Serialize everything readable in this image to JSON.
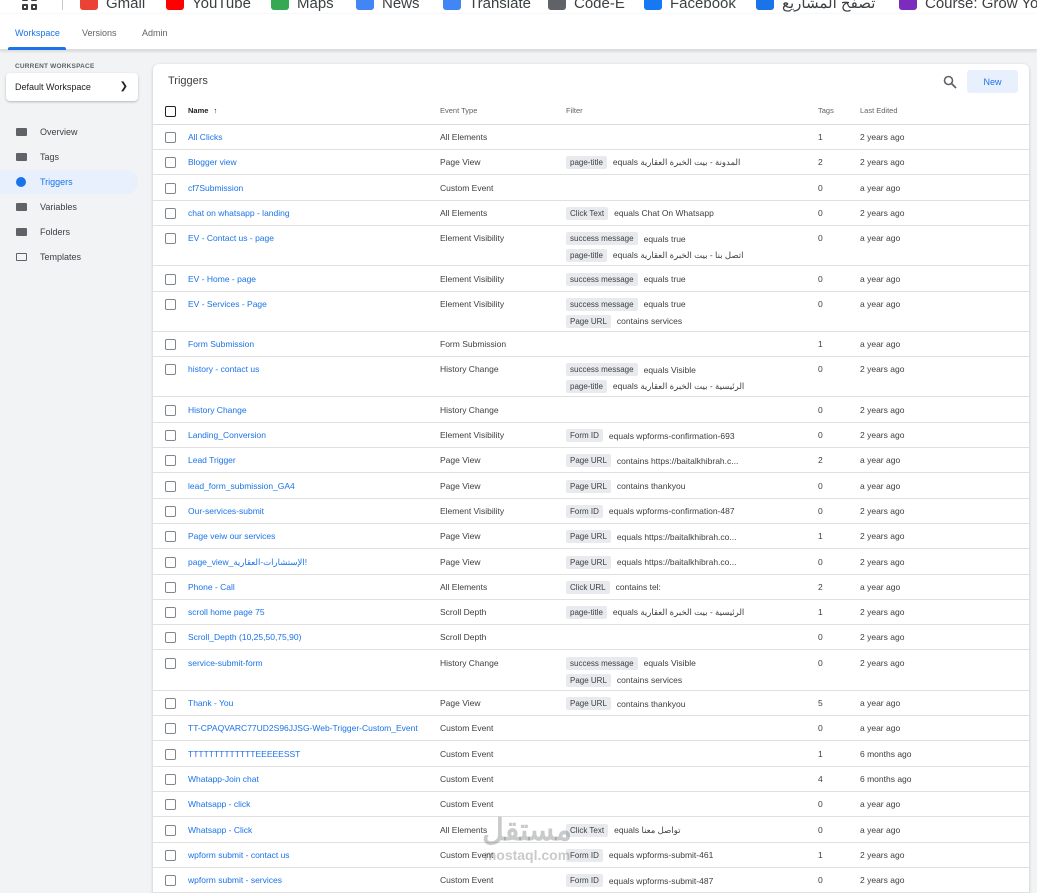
{
  "bookmarks": [
    {
      "label": "Gmail",
      "icon": "gmail-icon",
      "color": "#ea4335"
    },
    {
      "label": "YouTube",
      "icon": "youtube-icon",
      "color": "#ff0000"
    },
    {
      "label": "Maps",
      "icon": "maps-icon",
      "color": "#34a853"
    },
    {
      "label": "News",
      "icon": "news-icon",
      "color": "#4285f4"
    },
    {
      "label": "Translate",
      "icon": "translate-icon",
      "color": "#4285f4"
    },
    {
      "label": "Code-E",
      "icon": "code-e-icon",
      "color": "#5f6368"
    },
    {
      "label": "Facebook",
      "icon": "facebook-icon",
      "color": "#1877f2"
    },
    {
      "label": "تصفح المشاريع",
      "icon": "projects-icon",
      "color": "#1a73e8"
    },
    {
      "label": "Course: Grow Yo",
      "icon": "course-icon",
      "color": "#7b2cbf"
    }
  ],
  "topnav": {
    "tabs": [
      "Workspace",
      "Versions",
      "Admin"
    ],
    "active": "Workspace"
  },
  "sidebar": {
    "current_workspace_label": "CURRENT WORKSPACE",
    "workspace_name": "Default Workspace",
    "items": [
      {
        "label": "Overview",
        "icon": "overview-icon",
        "active": false
      },
      {
        "label": "Tags",
        "icon": "tag-icon",
        "active": false
      },
      {
        "label": "Triggers",
        "icon": "trigger-icon",
        "active": true
      },
      {
        "label": "Variables",
        "icon": "variables-icon",
        "active": false
      },
      {
        "label": "Folders",
        "icon": "folder-icon",
        "active": false
      },
      {
        "label": "Templates",
        "icon": "template-icon",
        "active": false
      }
    ]
  },
  "main": {
    "title": "Triggers",
    "new_label": "New",
    "columns": {
      "name": "Name",
      "sort_arrow": "↑",
      "event_type": "Event Type",
      "filter": "Filter",
      "tags": "Tags",
      "last_edited": "Last Edited"
    },
    "rows": [
      {
        "name": "All Clicks",
        "event": "All Elements",
        "filters": [],
        "tags": "1",
        "edited": "2 years ago"
      },
      {
        "name": "Blogger view",
        "event": "Page View",
        "filters": [
          {
            "chip": "page-title",
            "text": "equals المدونة - بيت الخبرة العقارية"
          }
        ],
        "tags": "2",
        "edited": "2 years ago"
      },
      {
        "name": "cf7Submission",
        "event": "Custom Event",
        "filters": [],
        "tags": "0",
        "edited": "a year ago"
      },
      {
        "name": "chat on whatsapp - landing",
        "event": "All Elements",
        "filters": [
          {
            "chip": "Click Text",
            "text": "equals Chat On Whatsapp"
          }
        ],
        "tags": "0",
        "edited": "2 years ago"
      },
      {
        "name": "EV - Contact us - page",
        "event": "Element Visibility",
        "filters": [
          {
            "chip": "success message",
            "text": "equals true"
          },
          {
            "chip": "page-title",
            "text": "equals اتصل بنا - بيت الخبرة العقارية"
          }
        ],
        "tags": "0",
        "edited": "a year ago"
      },
      {
        "name": "EV - Home - page",
        "event": "Element Visibility",
        "filters": [
          {
            "chip": "success message",
            "text": "equals true"
          }
        ],
        "tags": "0",
        "edited": "a year ago"
      },
      {
        "name": "EV - Services - Page",
        "event": "Element Visibility",
        "filters": [
          {
            "chip": "success message",
            "text": "equals true"
          },
          {
            "chip": "Page URL",
            "text": "contains services"
          }
        ],
        "tags": "0",
        "edited": "a year ago"
      },
      {
        "name": "Form Submission",
        "event": "Form Submission",
        "filters": [],
        "tags": "1",
        "edited": "a year ago"
      },
      {
        "name": "history - contact us",
        "event": "History Change",
        "filters": [
          {
            "chip": "success message",
            "text": "equals Visible"
          },
          {
            "chip": "page-title",
            "text": "equals الرئيسية - بيت الخبرة العقارية"
          }
        ],
        "tags": "0",
        "edited": "2 years ago"
      },
      {
        "name": "History Change",
        "event": "History Change",
        "filters": [],
        "tags": "0",
        "edited": "2 years ago"
      },
      {
        "name": "Landing_Conversion",
        "event": "Element Visibility",
        "filters": [
          {
            "chip": "Form ID",
            "text": "equals wpforms-confirmation-693"
          }
        ],
        "tags": "0",
        "edited": "2 years ago"
      },
      {
        "name": "Lead Trigger",
        "event": "Page View",
        "filters": [
          {
            "chip": "Page URL",
            "text": "contains https://baitalkhibrah.c..."
          }
        ],
        "tags": "2",
        "edited": "a year ago"
      },
      {
        "name": "lead_form_submission_GA4",
        "event": "Page View",
        "filters": [
          {
            "chip": "Page URL",
            "text": "contains thankyou"
          }
        ],
        "tags": "0",
        "edited": "a year ago"
      },
      {
        "name": "Our-services-submit",
        "event": "Element Visibility",
        "filters": [
          {
            "chip": "Form ID",
            "text": "equals wpforms-confirmation-487"
          }
        ],
        "tags": "0",
        "edited": "2 years ago"
      },
      {
        "name": "Page veiw our services",
        "event": "Page View",
        "filters": [
          {
            "chip": "Page URL",
            "text": "equals https://baitalkhibrah.co..."
          }
        ],
        "tags": "1",
        "edited": "2 years ago"
      },
      {
        "name": "page_view_الإستشارات-العقارية!",
        "event": "Page View",
        "filters": [
          {
            "chip": "Page URL",
            "text": "equals https://baitalkhibrah.co..."
          }
        ],
        "tags": "0",
        "edited": "2 years ago"
      },
      {
        "name": "Phone - Call",
        "event": "All Elements",
        "filters": [
          {
            "chip": "Click URL",
            "text": "contains tel:"
          }
        ],
        "tags": "2",
        "edited": "a year ago"
      },
      {
        "name": "scroll home page 75",
        "event": "Scroll Depth",
        "filters": [
          {
            "chip": "page-title",
            "text": "equals الرئيسية - بيت الخبرة العقارية"
          }
        ],
        "tags": "1",
        "edited": "2 years ago"
      },
      {
        "name": "Scroll_Depth (10,25,50,75,90)",
        "event": "Scroll Depth",
        "filters": [],
        "tags": "0",
        "edited": "2 years ago"
      },
      {
        "name": "service-submit-form",
        "event": "History Change",
        "filters": [
          {
            "chip": "success message",
            "text": "equals Visible"
          },
          {
            "chip": "Page URL",
            "text": "contains services"
          }
        ],
        "tags": "0",
        "edited": "2 years ago"
      },
      {
        "name": "Thank - You",
        "event": "Page View",
        "filters": [
          {
            "chip": "Page URL",
            "text": "contains thankyou"
          }
        ],
        "tags": "5",
        "edited": "a year ago"
      },
      {
        "name": "TT-CPAQVARC77UD2S96JJSG-Web-Trigger-Custom_Event",
        "event": "Custom Event",
        "filters": [],
        "tags": "0",
        "edited": "a year ago"
      },
      {
        "name": "TTTTTTTTTTTTTEEEEESST",
        "event": "Custom Event",
        "filters": [],
        "tags": "1",
        "edited": "6 months ago"
      },
      {
        "name": "Whatapp-Join chat",
        "event": "Custom Event",
        "filters": [],
        "tags": "4",
        "edited": "6 months ago"
      },
      {
        "name": "Whatsapp - click",
        "event": "Custom Event",
        "filters": [],
        "tags": "0",
        "edited": "a year ago"
      },
      {
        "name": "Whatsapp - Click",
        "event": "All Elements",
        "filters": [
          {
            "chip": "Click Text",
            "text": "equals تواصل معنا"
          }
        ],
        "tags": "0",
        "edited": "a year ago"
      },
      {
        "name": "wpform submit - contact us",
        "event": "Custom Event",
        "filters": [
          {
            "chip": "Form ID",
            "text": "equals wpforms-submit-461"
          }
        ],
        "tags": "1",
        "edited": "2 years ago"
      },
      {
        "name": "wpform submit - services",
        "event": "Custom Event",
        "filters": [
          {
            "chip": "Form ID",
            "text": "equals wpforms-submit-487"
          }
        ],
        "tags": "0",
        "edited": "2 years ago"
      }
    ]
  },
  "watermark": {
    "line1": "مستقل",
    "line2": "mostaql.com"
  }
}
